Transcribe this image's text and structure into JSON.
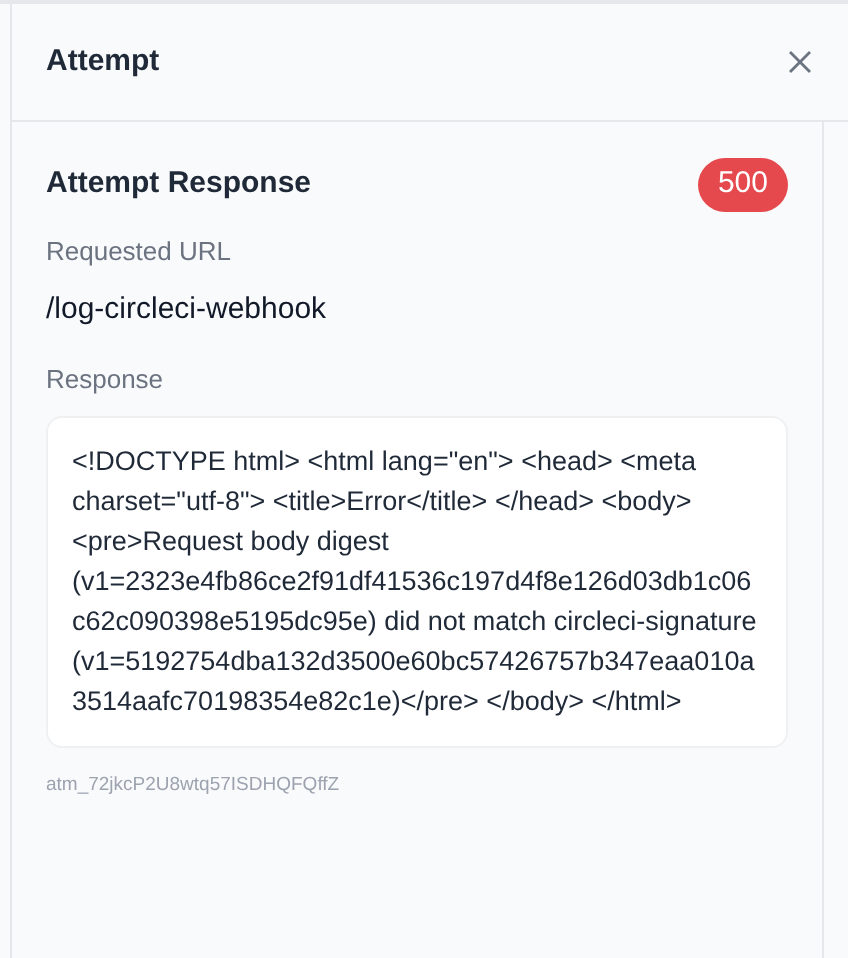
{
  "panel": {
    "title": "Attempt"
  },
  "attempt_response": {
    "heading": "Attempt Response",
    "status_code": "500",
    "requested_url_label": "Requested URL",
    "requested_url": "/log-circleci-webhook",
    "response_label": "Response",
    "response_body": "<!DOCTYPE html> <html lang=\"en\"> <head> <meta charset=\"utf-8\"> <title>Error</title> </head> <body> <pre>Request body digest (v1=2323e4fb86ce2f91df41536c197d4f8e126d03db1c06c62c090398e5195dc95e) did not match circleci-signature (v1=5192754dba132d3500e60bc57426757b347eaa010a3514aafc70198354e82c1e)</pre> </body> </html>",
    "attempt_id": "atm_72jkcP2U8wtq57ISDHQFQffZ"
  }
}
